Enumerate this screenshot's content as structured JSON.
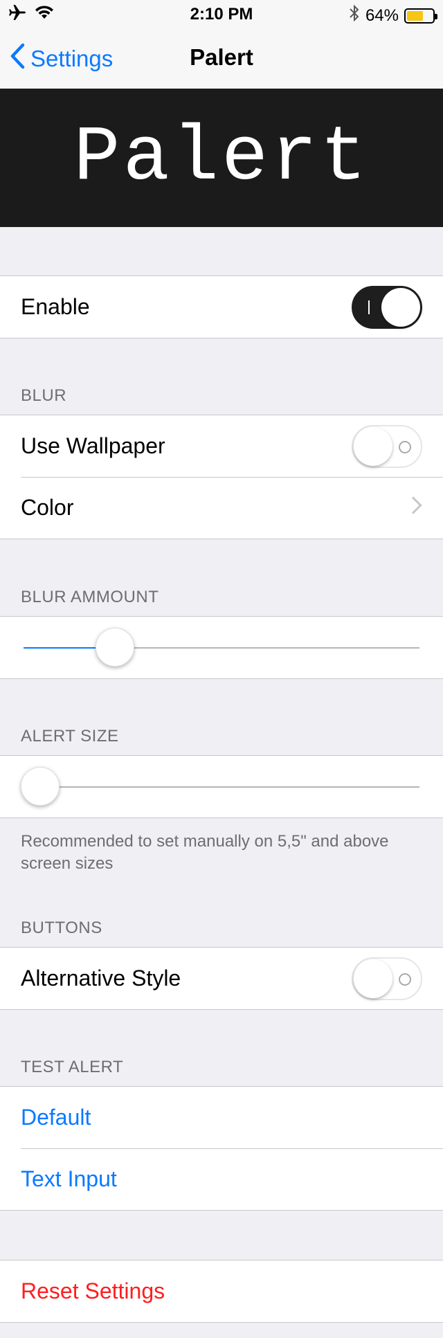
{
  "status_bar": {
    "time": "2:10 PM",
    "battery_text": "64%",
    "battery_level": 0.64,
    "battery_color": "#f5c518",
    "icons": [
      "airplane-icon",
      "wifi-icon",
      "bluetooth-icon",
      "battery-icon"
    ]
  },
  "nav": {
    "back_label": "Settings",
    "title": "Palert"
  },
  "banner": {
    "text": "Palert"
  },
  "enable_group": {
    "enable_label": "Enable",
    "enable_on": true
  },
  "blur": {
    "header": "BLUR",
    "use_wallpaper_label": "Use Wallpaper",
    "use_wallpaper_on": false,
    "color_label": "Color"
  },
  "blur_amount": {
    "header": "BLUR AMMOUNT",
    "value": 0.23
  },
  "alert_size": {
    "header": "ALERT SIZE",
    "value": 0.0,
    "footer": "Recommended to set manually on 5,5\" and above screen sizes"
  },
  "buttons": {
    "header": "BUTTONS",
    "alternative_style_label": "Alternative Style",
    "alternative_style_on": false
  },
  "test_alert": {
    "header": "TEST ALERT",
    "default_label": "Default",
    "text_input_label": "Text Input"
  },
  "reset": {
    "label": "Reset Settings"
  },
  "colors": {
    "accent": "#0a7aff",
    "destructive": "#ff1e1e",
    "banner_bg": "#1b1b1b"
  }
}
